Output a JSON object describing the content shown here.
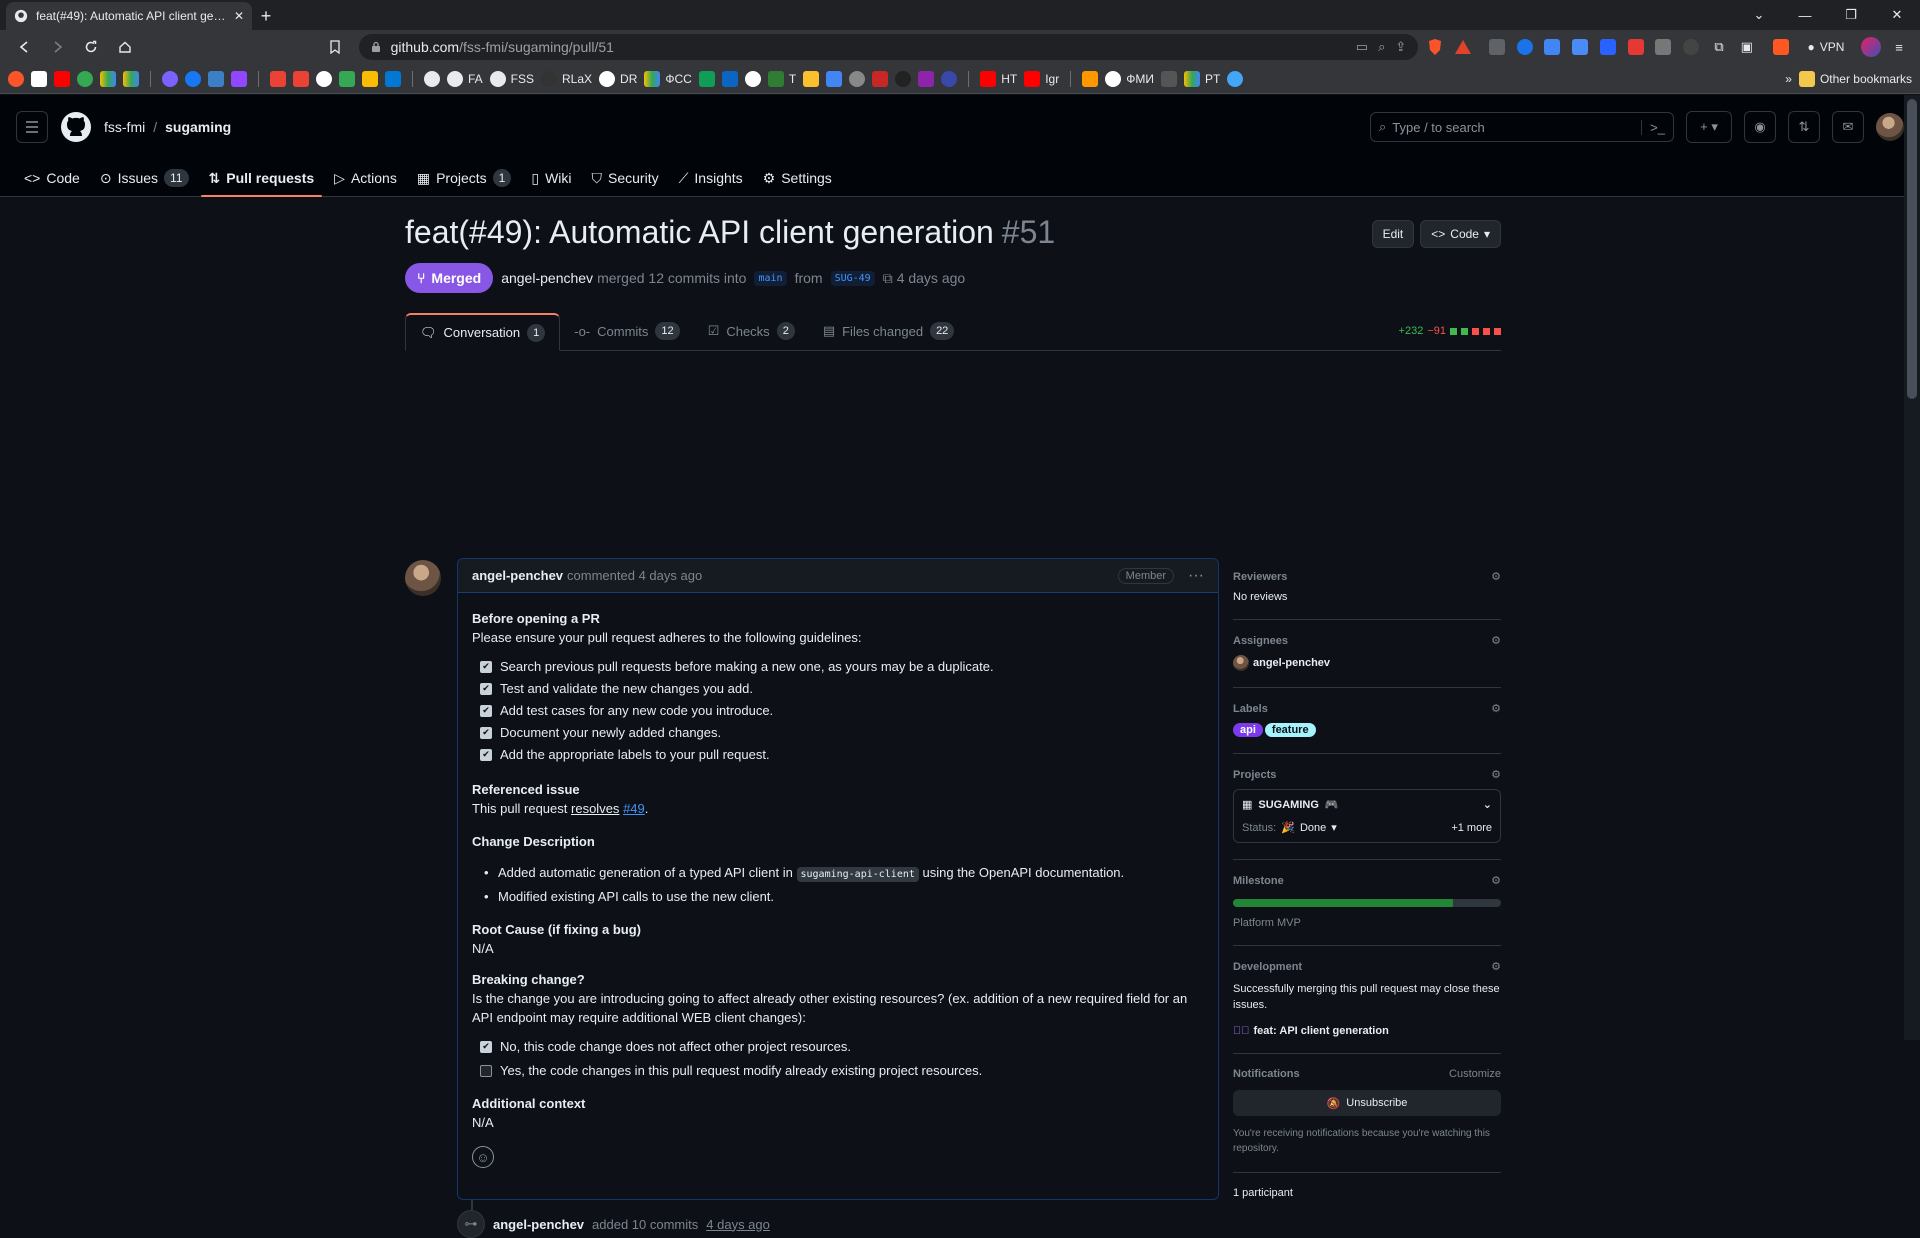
{
  "browser": {
    "tab_title": "feat(#49): Automatic API client generation",
    "url_domain": "github.com",
    "url_path": "/fss-fmi/sugaming/pull/51",
    "vpn_label": "VPN",
    "bookmarks": [
      "FA",
      "FSS",
      "RLaX",
      "DR",
      "ФСС",
      "T",
      "HT",
      "Igr",
      "ФМИ",
      "PT"
    ],
    "other_bookmarks": "Other bookmarks"
  },
  "github": {
    "owner": "fss-fmi",
    "repo": "sugaming",
    "search_placeholder": "Type / to search",
    "nav": [
      {
        "label": "Code",
        "count": ""
      },
      {
        "label": "Issues",
        "count": "11"
      },
      {
        "label": "Pull requests",
        "count": ""
      },
      {
        "label": "Actions",
        "count": ""
      },
      {
        "label": "Projects",
        "count": "1"
      },
      {
        "label": "Wiki",
        "count": ""
      },
      {
        "label": "Security",
        "count": ""
      },
      {
        "label": "Insights",
        "count": ""
      },
      {
        "label": "Settings",
        "count": ""
      }
    ]
  },
  "pr": {
    "title": "feat(#49): Automatic API client generation",
    "number": "#51",
    "edit_label": "Edit",
    "code_label": "Code",
    "state": "Merged",
    "author": "angel-penchev",
    "merged_text": "merged 12 commits into",
    "base": "main",
    "from_text": "from",
    "head": "SUG-49",
    "when": "4 days ago",
    "tabs": [
      {
        "label": "Conversation",
        "count": "1"
      },
      {
        "label": "Commits",
        "count": "12"
      },
      {
        "label": "Checks",
        "count": "2"
      },
      {
        "label": "Files changed",
        "count": "22"
      }
    ],
    "additions": "+232",
    "deletions": "−91"
  },
  "comment": {
    "author": "angel-penchev",
    "action": "commented",
    "when": "4 days ago",
    "badge": "Member",
    "h_before": "Before opening a PR",
    "p_before": "Please ensure your pull request adheres to the following guidelines:",
    "checklist": [
      {
        "text": "Search previous pull requests before making a new one, as yours may be a duplicate.",
        "checked": true
      },
      {
        "text": "Test and validate the new changes you add.",
        "checked": true
      },
      {
        "text": "Add test cases for any new code you introduce.",
        "checked": true
      },
      {
        "text": "Document your newly added changes.",
        "checked": true
      },
      {
        "text": "Add the appropriate labels to your pull request.",
        "checked": true
      }
    ],
    "h_ref": "Referenced issue",
    "p_ref_prefix": "This pull request",
    "p_ref_resolves": "resolves",
    "p_ref_issue": "#49",
    "p_ref_suffix": ".",
    "h_change": "Change Description",
    "bullet1_pre": "Added automatic generation of a typed API client in",
    "bullet1_code": "sugaming-api-client",
    "bullet1_post": "using the OpenAPI documentation.",
    "bullet2": "Modified existing API calls to use the new client.",
    "h_root": "Root Cause (if fixing a bug)",
    "p_root": "N/A",
    "h_break": "Breaking change?",
    "p_break": "Is the change you are introducing going to affect already other existing resources? (ex. addition of a new required field for an API endpoint may require additional WEB client changes):",
    "break_checks": [
      {
        "text": "No, this code change does not affect other project resources.",
        "checked": true
      },
      {
        "text": "Yes, the code changes in this pull request modify already existing project resources.",
        "checked": false
      }
    ],
    "h_ctx": "Additional context",
    "p_ctx": "N/A"
  },
  "event": {
    "author": "angel-penchev",
    "text": "added 10 commits",
    "when": "4 days ago"
  },
  "sidebar": {
    "reviewers_title": "Reviewers",
    "reviewers_value": "No reviews",
    "assignees_title": "Assignees",
    "assignee": "angel-penchev",
    "labels_title": "Labels",
    "labels": [
      {
        "name": "api",
        "color": "#7c3aed"
      },
      {
        "name": "feature",
        "color": "#a5f3fc"
      }
    ],
    "projects_title": "Projects",
    "project_name": "SUGAMING",
    "status_label": "Status:",
    "status_value": "Done",
    "more": "+1 more",
    "milestone_title": "Milestone",
    "milestone_name": "Platform MVP",
    "milestone_progress": 0.82,
    "development_title": "Development",
    "development_text": "Successfully merging this pull request may close these issues.",
    "development_issue": "feat: API client generation",
    "notifications_title": "Notifications",
    "customize": "Customize",
    "unsubscribe": "Unsubscribe",
    "notif_reason": "You're receiving notifications because you're watching this repository.",
    "participants": "1 participant"
  }
}
